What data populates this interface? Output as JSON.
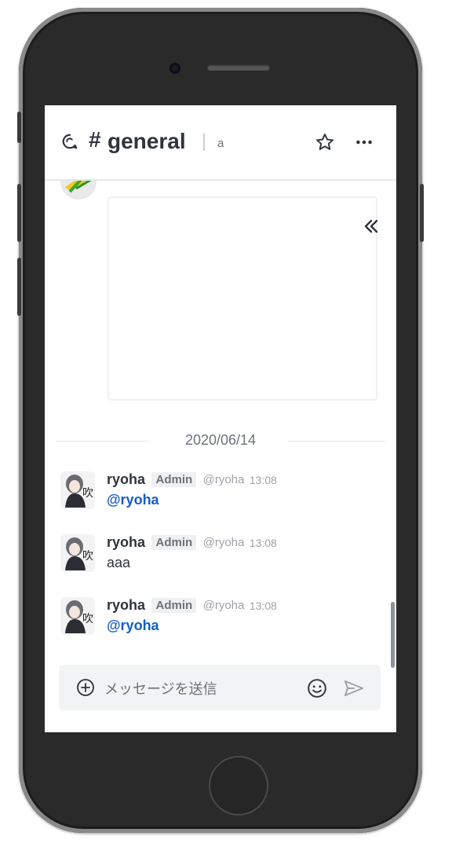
{
  "header": {
    "hash": "#",
    "room_name": "general",
    "topic": "a"
  },
  "date_separator": "2020/06/14",
  "messages": [
    {
      "username": "ryoha",
      "role": "Admin",
      "handle": "@ryoha",
      "time": "13:08",
      "text": "@ryoha",
      "is_mention": true
    },
    {
      "username": "ryoha",
      "role": "Admin",
      "handle": "@ryoha",
      "time": "13:08",
      "text": "aaa",
      "is_mention": false
    },
    {
      "username": "ryoha",
      "role": "Admin",
      "handle": "@ryoha",
      "time": "13:08",
      "text": "@ryoha",
      "is_mention": true
    }
  ],
  "composer": {
    "placeholder": "メッセージを送信"
  },
  "icons": [
    "room-discussion-icon",
    "star-icon",
    "kebab-icon",
    "collapse-icon",
    "plus-circle-icon",
    "emoji-icon",
    "send-icon"
  ],
  "colors": {
    "mention": "#175cc4",
    "text": "#2f343d",
    "muted": "#6c727a",
    "composer_bg": "#f2f3f5"
  }
}
